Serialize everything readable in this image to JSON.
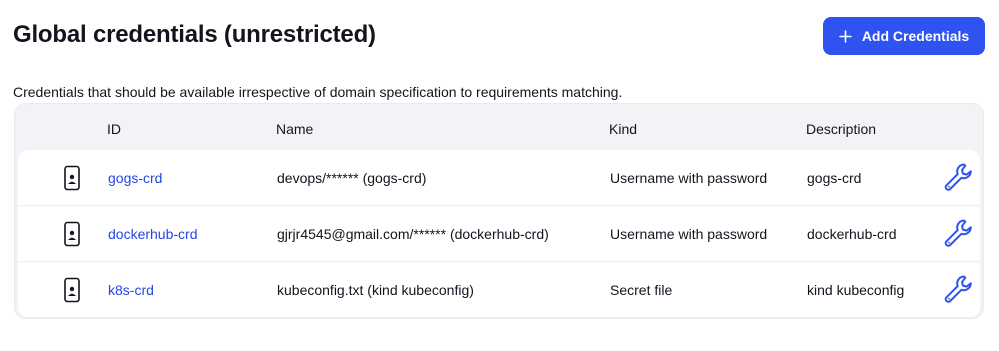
{
  "header": {
    "title": "Global credentials (unrestricted)",
    "add_button_label": "Add Credentials"
  },
  "description": "Credentials that should be available irrespective of domain specification to requirements matching.",
  "table": {
    "columns": [
      "ID",
      "Name",
      "Kind",
      "Description"
    ],
    "rows": [
      {
        "id": "gogs-crd",
        "name": "devops/****** (gogs-crd)",
        "kind": "Username with password",
        "description": "gogs-crd"
      },
      {
        "id": "dockerhub-crd",
        "name": "gjrjr4545@gmail.com/****** (dockerhub-crd)",
        "kind": "Username with password",
        "description": "dockerhub-crd"
      },
      {
        "id": "k8s-crd",
        "name": "kubeconfig.txt (kind kubeconfig)",
        "kind": "Secret file",
        "description": "kind kubeconfig"
      }
    ]
  },
  "icons": {
    "add": "plus-icon",
    "credential_type": "mobile-device-icon",
    "edit": "wrench-icon"
  },
  "colors": {
    "accent": "#2e53f0",
    "link": "#2447e0",
    "table_bg": "#f2f3f7"
  }
}
